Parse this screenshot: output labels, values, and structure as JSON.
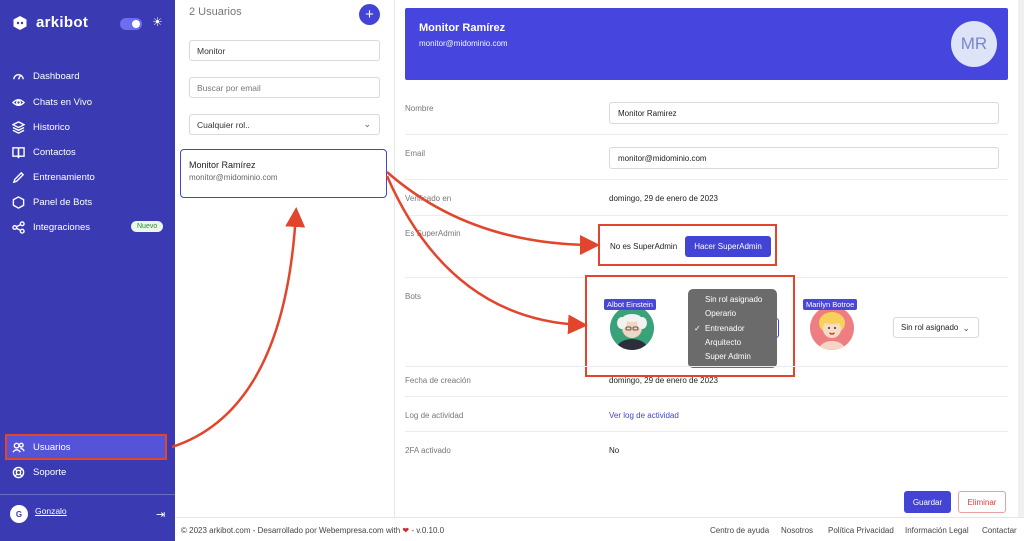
{
  "app": {
    "name": "arkibot"
  },
  "sidebar": {
    "items": [
      {
        "label": "Dashboard",
        "icon": "dashboard-icon"
      },
      {
        "label": "Chats en Vivo",
        "icon": "eye-icon"
      },
      {
        "label": "Historico",
        "icon": "layers-icon"
      },
      {
        "label": "Contactos",
        "icon": "book-icon"
      },
      {
        "label": "Entrenamiento",
        "icon": "pencil-icon"
      },
      {
        "label": "Panel de Bots",
        "icon": "hexagon-icon"
      },
      {
        "label": "Integraciones",
        "icon": "share-icon",
        "badge": "Nuevo"
      }
    ],
    "bottom": [
      {
        "label": "Usuarios",
        "icon": "users-icon"
      },
      {
        "label": "Soporte",
        "icon": "lifebuoy-icon"
      }
    ],
    "user": {
      "initial": "G",
      "name": "Gonzalo"
    }
  },
  "list": {
    "count": "2 Usuarios",
    "add_label": "+",
    "name_filter": "Monitor",
    "email_placeholder": "Buscar por email",
    "role_filter": "Cualquier rol..",
    "card": {
      "name": "Monitor Ramírez",
      "email": "monitor@midominio.com"
    }
  },
  "detail": {
    "name": "Monitor Ramírez",
    "email": "monitor@midominio.com",
    "initials": "MR",
    "fields": {
      "nombre_label": "Nombre",
      "nombre_value": "Monitor Ramirez",
      "email_label": "Email",
      "email_value": "monitor@midominio.com",
      "verified_label": "Verificado en",
      "verified_value": "domingo, 29 de enero de 2023",
      "superadmin_label": "Es SuperAdmin",
      "superadmin_value": "No es SuperAdmin",
      "superadmin_button": "Hacer SuperAdmin",
      "bots_label": "Bots",
      "created_label": "Fecha de creación",
      "created_value": "domingo, 29 de enero de 2023",
      "log_label": "Log de actividad",
      "log_value": "Ver log de actividad",
      "twofa_label": "2FA activado",
      "twofa_value": "No"
    },
    "bots": [
      {
        "name": "Albot Einstein"
      },
      {
        "name": "Marilyn Botroe",
        "role": "Sin rol asignado"
      }
    ],
    "role_menu": [
      "Sin rol asignado",
      "Operario",
      "Entrenador",
      "Arquitecto",
      "Super Admin"
    ],
    "role_selected": "Entrenador",
    "save_label": "Guardar",
    "delete_label": "Eliminar"
  },
  "footer": {
    "copyright": "© 2023 arkibot.com - Desarrollado por Webempresa.com with",
    "version": "- v.0.10.0",
    "links": [
      "Centro de ayuda",
      "Nosotros",
      "Política Privacidad",
      "Información Legal",
      "Contactar"
    ]
  },
  "colors": {
    "primary": "#4343d6",
    "sidebar": "#3a3ab3",
    "annotation": "#e2452b"
  }
}
